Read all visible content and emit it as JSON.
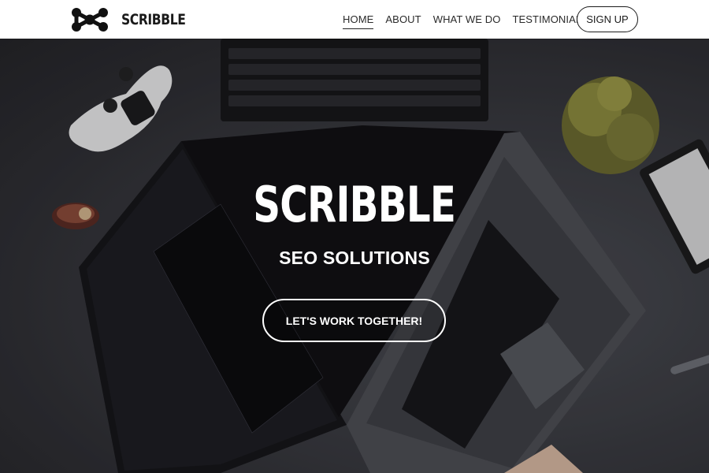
{
  "header": {
    "brand_name": "SCRIBBLE",
    "logo_icon": "linked-nodes-logo-icon",
    "nav": [
      {
        "label": "HOME",
        "active": true
      },
      {
        "label": "ABOUT",
        "active": false
      },
      {
        "label": "WHAT WE DO",
        "active": false
      },
      {
        "label": "TESTIMONIALS",
        "active": false
      }
    ],
    "signup_label": "SIGN UP"
  },
  "hero": {
    "title": "SCRIBBLE",
    "subtitle": "SEO SOLUTIONS",
    "cta_label": "LET'S WORK TOGETHER!",
    "background_image": "desk-with-laptops-controller-plant-photo"
  },
  "colors": {
    "header_bg": "#ffffff",
    "header_text": "#2a2a2a",
    "hero_text": "#ffffff"
  }
}
